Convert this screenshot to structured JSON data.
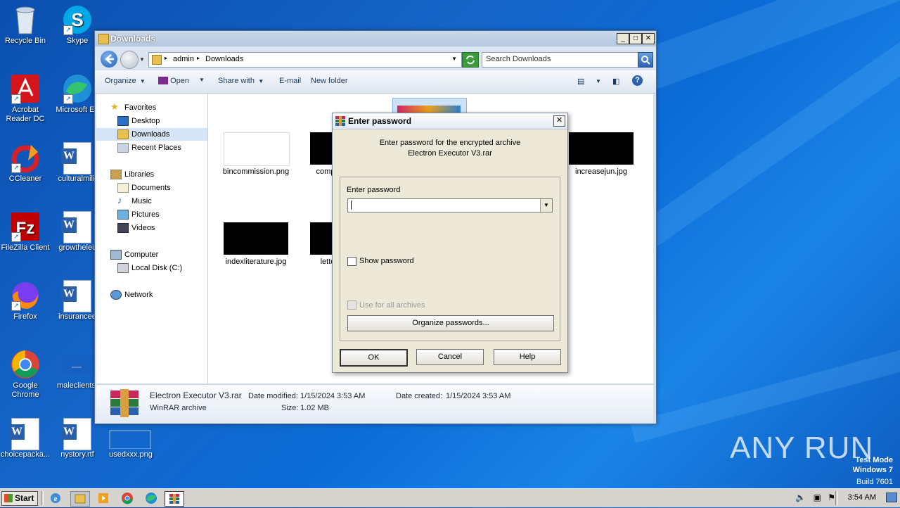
{
  "desktop": {
    "icons": [
      {
        "label": "Recycle Bin"
      },
      {
        "label": "Skype"
      },
      {
        "label": "Acrobat Reader DC"
      },
      {
        "label": "Microsoft Ed"
      },
      {
        "label": "CCleaner"
      },
      {
        "label": "culturalmilit"
      },
      {
        "label": "FileZilla Client"
      },
      {
        "label": "growthelec"
      },
      {
        "label": "Firefox"
      },
      {
        "label": "insurancee"
      },
      {
        "label": "Google Chrome"
      },
      {
        "label": "maleclients."
      },
      {
        "label": "choicepacka..."
      },
      {
        "label": "nystory.rtf"
      },
      {
        "label": "usedxxx.png"
      }
    ],
    "brand": "ANY RUN",
    "watermark": {
      "line1": "Test Mode",
      "line2": "Windows 7",
      "line3": "Build 7601"
    }
  },
  "explorer": {
    "title": "Downloads",
    "breadcrumb": [
      "admin",
      "Downloads"
    ],
    "search_placeholder": "Search Downloads",
    "toolbar": {
      "organize": "Organize",
      "open": "Open",
      "share_with": "Share with",
      "email": "E-mail",
      "new_folder": "New folder"
    },
    "nav": {
      "favorites": "Favorites",
      "desktop": "Desktop",
      "downloads": "Downloads",
      "recent_places": "Recent Places",
      "libraries": "Libraries",
      "documents": "Documents",
      "music": "Music",
      "pictures": "Pictures",
      "videos": "Videos",
      "computer": "Computer",
      "local_disk": "Local Disk (C:)",
      "network": "Network"
    },
    "files": [
      {
        "name": "bincommission.png"
      },
      {
        "name": "compu"
      },
      {
        "name": "increasejun.jpg"
      },
      {
        "name": "indexliterature.jpg"
      },
      {
        "name": "lette"
      }
    ],
    "details": {
      "file_name": "Electron Executor V3.rar",
      "type": "WinRAR archive",
      "date_modified_label": "Date modified:",
      "date_modified": "1/15/2024 3:53 AM",
      "date_created_label": "Date created:",
      "date_created": "1/15/2024 3:53 AM",
      "size_label": "Size:",
      "size": "1.02 MB"
    }
  },
  "dialog": {
    "title": "Enter password",
    "message_line1": "Enter password for the encrypted archive",
    "message_line2": "Electron Executor V3.rar",
    "password_label": "Enter password",
    "password_value": "",
    "show_password": "Show password",
    "use_for_all": "Use for all archives",
    "organize_passwords": "Organize passwords...",
    "ok": "OK",
    "cancel": "Cancel",
    "help": "Help"
  },
  "taskbar": {
    "start": "Start",
    "clock": "3:54 AM"
  }
}
